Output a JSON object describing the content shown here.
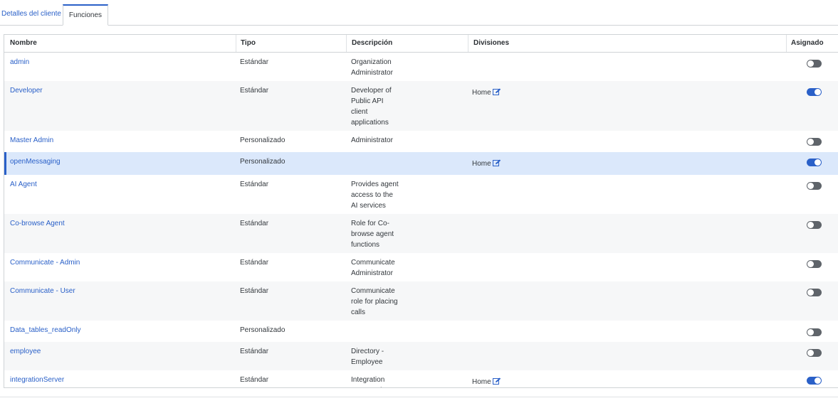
{
  "tabs": [
    {
      "label": "Detalles del cliente",
      "active": false
    },
    {
      "label": "Funciones",
      "active": true
    }
  ],
  "columns": {
    "name": "Nombre",
    "type": "Tipo",
    "description": "Descripción",
    "divisions": "Divisiones",
    "assigned": "Asignado"
  },
  "colors": {
    "accent": "#2a60c8",
    "toggle_off": "#5f646a",
    "selected_row": "#dbe8fb"
  },
  "rows": [
    {
      "name": "admin",
      "type": "Estándar",
      "description": "Organization Administrator",
      "division": "",
      "assigned": false
    },
    {
      "name": "Developer",
      "type": "Estándar",
      "description": "Developer of Public API client applications",
      "division": "Home",
      "assigned": true
    },
    {
      "name": "Master Admin",
      "type": "Personalizado",
      "description": "Administrator",
      "division": "",
      "assigned": false
    },
    {
      "name": "openMessaging",
      "type": "Personalizado",
      "description": "",
      "division": "Home",
      "assigned": true,
      "selected": true
    },
    {
      "name": "AI Agent",
      "type": "Estándar",
      "description": "Provides agent access to the AI services",
      "division": "",
      "assigned": false
    },
    {
      "name": "Co-browse Agent",
      "type": "Estándar",
      "description": "Role for Co-browse agent functions",
      "division": "",
      "assigned": false
    },
    {
      "name": "Communicate - Admin",
      "type": "Estándar",
      "description": "Communicate Administrator",
      "division": "",
      "assigned": false
    },
    {
      "name": "Communicate - User",
      "type": "Estándar",
      "description": "Communicate role for placing calls",
      "division": "",
      "assigned": false
    },
    {
      "name": "Data_tables_readOnly",
      "type": "Personalizado",
      "description": "",
      "division": "",
      "assigned": false
    },
    {
      "name": "employee",
      "type": "Estándar",
      "description": "Directory - Employee",
      "division": "",
      "assigned": false
    },
    {
      "name": "integrationServer",
      "type": "Estándar",
      "description": "Integration Server role",
      "division": "Home",
      "assigned": true
    }
  ]
}
